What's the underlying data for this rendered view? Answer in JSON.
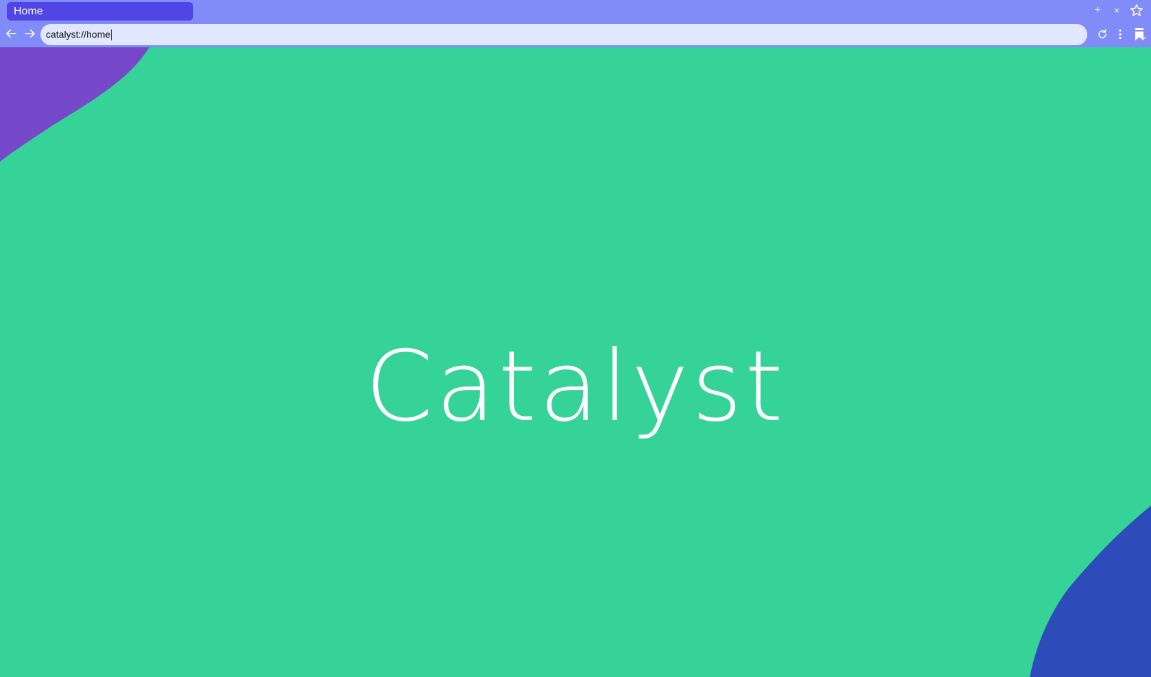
{
  "browser": {
    "tab": {
      "title": "Home"
    },
    "address_bar": {
      "value": "catalyst://home"
    },
    "toolbar": {
      "new_tab_glyph": "+",
      "close_tab_glyph": "×"
    },
    "icons": {
      "back": "back-arrow-icon",
      "forward": "forward-arrow-icon",
      "star": "star-icon",
      "reload": "reload-icon",
      "menu": "kebab-menu-icon",
      "bookmarks": "bookmarks-icon"
    }
  },
  "page": {
    "title": "Catalyst",
    "colors": {
      "background": "#36d399",
      "chrome": "#818cf8",
      "tab": "#4f46e5",
      "address_bar": "#e0e7ff",
      "blob_top_left": "#7649cb",
      "blob_bottom_right": "#2e4bba"
    }
  }
}
